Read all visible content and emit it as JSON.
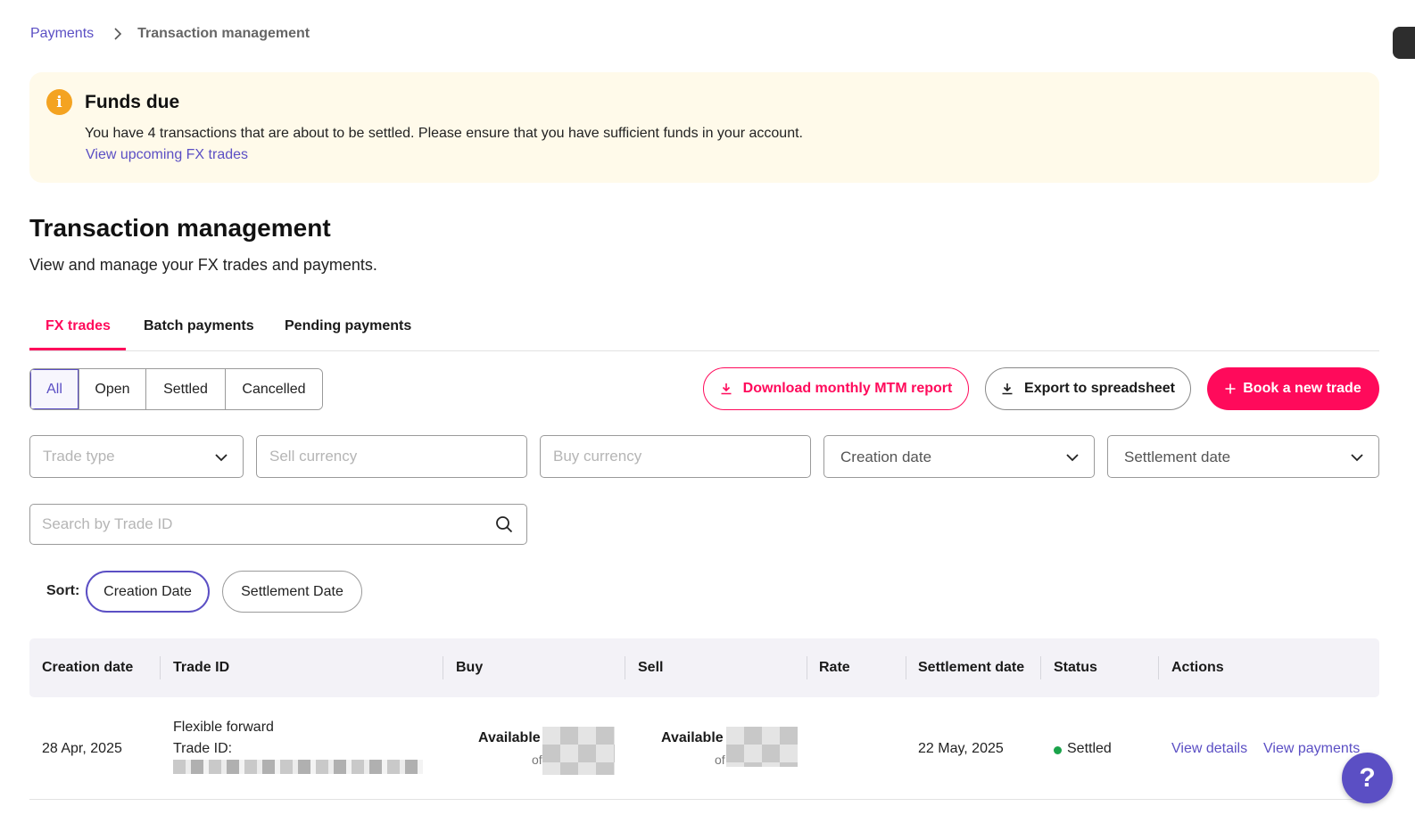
{
  "breadcrumb": {
    "root": "Payments",
    "current": "Transaction management"
  },
  "banner": {
    "title": "Funds due",
    "message": "You have 4 transactions that are about to be settled. Please ensure that you have sufficient funds in your account.",
    "link": "View upcoming FX trades",
    "icon": "info-icon",
    "color": "#f4a321"
  },
  "page": {
    "title": "Transaction management",
    "subtitle": "View and manage your FX trades and payments."
  },
  "tabs": [
    {
      "label": "FX trades",
      "active": true
    },
    {
      "label": "Batch payments",
      "active": false
    },
    {
      "label": "Pending payments",
      "active": false
    }
  ],
  "status_filter": [
    {
      "label": "All",
      "active": true
    },
    {
      "label": "Open",
      "active": false
    },
    {
      "label": "Settled",
      "active": false
    },
    {
      "label": "Cancelled",
      "active": false
    }
  ],
  "actions": {
    "download_mtm": "Download monthly MTM report",
    "export": "Export to spreadsheet",
    "book_trade": "Book a new trade"
  },
  "filters": {
    "trade_type_placeholder": "Trade type",
    "sell_currency_placeholder": "Sell currency",
    "buy_currency_placeholder": "Buy currency",
    "creation_date": "Creation date",
    "settlement_date": "Settlement date"
  },
  "search": {
    "placeholder": "Search by Trade ID"
  },
  "sort": {
    "label": "Sort:",
    "options": [
      "Creation Date",
      "Settlement Date"
    ],
    "active": "Creation Date"
  },
  "table": {
    "columns": [
      "Creation date",
      "Trade ID",
      "Buy",
      "Sell",
      "Rate",
      "Settlement date",
      "Status",
      "Actions"
    ],
    "rows": [
      {
        "creation_date": "28 Apr, 2025",
        "trade_type": "Flexible forward",
        "trade_id_label": "Trade ID:",
        "buy_label": "Available",
        "buy_of": "of",
        "sell_label": "Available",
        "sell_of": "of",
        "settlement_date": "22 May, 2025",
        "status": "Settled",
        "view_details": "View details",
        "view_payments": "View payments"
      }
    ]
  },
  "help": {
    "label": "?"
  },
  "colors": {
    "accent": "#ff0a5b",
    "link": "#5b4fc4",
    "status_settled": "#1aa34a"
  }
}
